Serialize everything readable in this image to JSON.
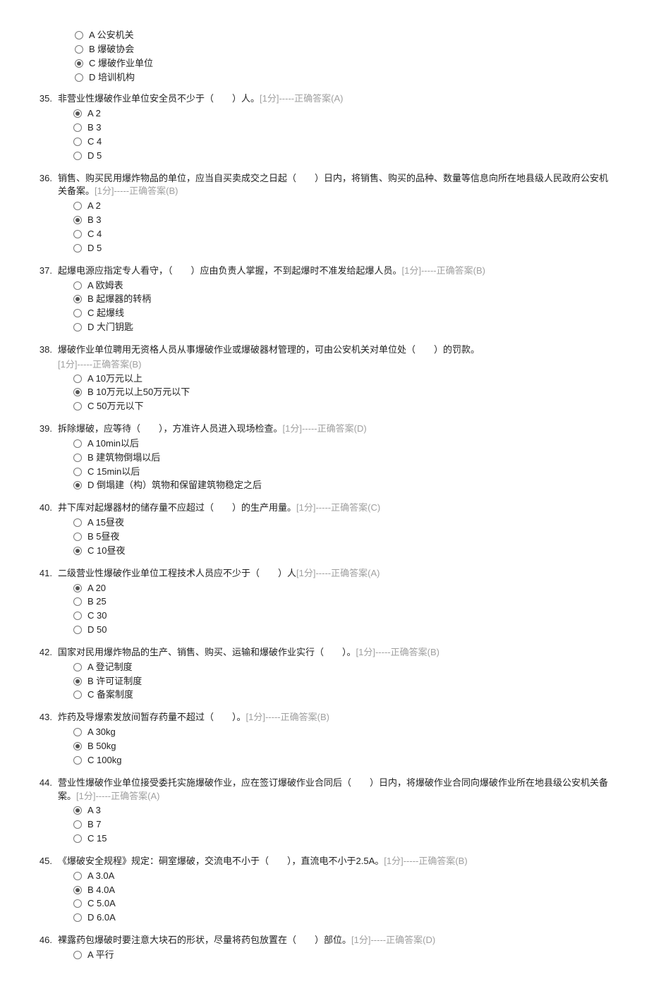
{
  "head_options": [
    {
      "letter": "A",
      "text": "公安机关",
      "selected": false
    },
    {
      "letter": "B",
      "text": "爆破协会",
      "selected": false
    },
    {
      "letter": "C",
      "text": "爆破作业单位",
      "selected": true
    },
    {
      "letter": "D",
      "text": "培训机构",
      "selected": false
    }
  ],
  "questions": [
    {
      "num": "35.",
      "stem": "非营业性爆破作业单位安全员不少于（　　）人。",
      "score": "[1分]-----正确答案(A)",
      "options": [
        {
          "letter": "A",
          "text": "2",
          "selected": true
        },
        {
          "letter": "B",
          "text": "3",
          "selected": false
        },
        {
          "letter": "C",
          "text": "4",
          "selected": false
        },
        {
          "letter": "D",
          "text": "5",
          "selected": false
        }
      ]
    },
    {
      "num": "36.",
      "stem": "销售、购买民用爆炸物品的单位，应当自买卖成交之日起（　　）日内，将销售、购买的品种、数量等信息向所在地县级人民政府公安机关备案。",
      "score": "[1分]-----正确答案(B)",
      "options": [
        {
          "letter": "A",
          "text": "2",
          "selected": false
        },
        {
          "letter": "B",
          "text": "3",
          "selected": true
        },
        {
          "letter": "C",
          "text": "4",
          "selected": false
        },
        {
          "letter": "D",
          "text": "5",
          "selected": false
        }
      ]
    },
    {
      "num": "37.",
      "stem": "起爆电源应指定专人看守，（　　）应由负责人掌握，不到起爆时不准发给起爆人员。",
      "score": "[1分]-----正确答案(B)",
      "options": [
        {
          "letter": "A",
          "text": "欧姆表",
          "selected": false
        },
        {
          "letter": "B",
          "text": "起爆器的转柄",
          "selected": true
        },
        {
          "letter": "C",
          "text": "起爆线",
          "selected": false
        },
        {
          "letter": "D",
          "text": "大门钥匙",
          "selected": false
        }
      ]
    },
    {
      "num": "38.",
      "stem": "爆破作业单位聘用无资格人员从事爆破作业或爆破器材管理的，可由公安机关对单位处（　　）的罚款。",
      "score": "[1分]-----正确答案(B)",
      "scoreOnNewLine": true,
      "options": [
        {
          "letter": "A",
          "text": "10万元以上",
          "selected": false
        },
        {
          "letter": "B",
          "text": "10万元以上50万元以下",
          "selected": true
        },
        {
          "letter": "C",
          "text": "50万元以下",
          "selected": false
        }
      ]
    },
    {
      "num": "39.",
      "stem": "拆除爆破，应等待（　　），方准许人员进入现场检查。",
      "score": "[1分]-----正确答案(D)",
      "options": [
        {
          "letter": "A",
          "text": "10min以后",
          "selected": false
        },
        {
          "letter": "B",
          "text": "建筑物倒塌以后",
          "selected": false
        },
        {
          "letter": "C",
          "text": "15min以后",
          "selected": false
        },
        {
          "letter": "D",
          "text": "倒塌建（构）筑物和保留建筑物稳定之后",
          "selected": true
        }
      ]
    },
    {
      "num": "40.",
      "stem": "井下库对起爆器材的储存量不应超过（　　）的生产用量。",
      "score": "[1分]-----正确答案(C)",
      "options": [
        {
          "letter": "A",
          "text": "15昼夜",
          "selected": false
        },
        {
          "letter": "B",
          "text": "5昼夜",
          "selected": false
        },
        {
          "letter": "C",
          "text": "10昼夜",
          "selected": true
        }
      ]
    },
    {
      "num": "41.",
      "stem": "二级营业性爆破作业单位工程技术人员应不少于（　　）人",
      "score": "[1分]-----正确答案(A)",
      "options": [
        {
          "letter": "A",
          "text": "20",
          "selected": true
        },
        {
          "letter": "B",
          "text": "25",
          "selected": false
        },
        {
          "letter": "C",
          "text": "30",
          "selected": false
        },
        {
          "letter": "D",
          "text": "50",
          "selected": false
        }
      ]
    },
    {
      "num": "42.",
      "stem": "国家对民用爆炸物品的生产、销售、购买、运输和爆破作业实行（　　）。",
      "score": "[1分]-----正确答案(B)",
      "options": [
        {
          "letter": "A",
          "text": "登记制度",
          "selected": false
        },
        {
          "letter": "B",
          "text": "许可证制度",
          "selected": true
        },
        {
          "letter": "C",
          "text": "备案制度",
          "selected": false
        }
      ]
    },
    {
      "num": "43.",
      "stem": "炸药及导爆索发放间暂存药量不超过（　　）。",
      "score": "[1分]-----正确答案(B)",
      "options": [
        {
          "letter": "A",
          "text": "30kg",
          "selected": false
        },
        {
          "letter": "B",
          "text": "50kg",
          "selected": true
        },
        {
          "letter": "C",
          "text": "100kg",
          "selected": false
        }
      ]
    },
    {
      "num": "44.",
      "stem": "营业性爆破作业单位接受委托实施爆破作业，应在签订爆破作业合同后（　　）日内，将爆破作业合同向爆破作业所在地县级公安机关备案。",
      "score": "[1分]-----正确答案(A)",
      "options": [
        {
          "letter": "A",
          "text": "3",
          "selected": true
        },
        {
          "letter": "B",
          "text": "7",
          "selected": false
        },
        {
          "letter": "C",
          "text": "15",
          "selected": false
        }
      ]
    },
    {
      "num": "45.",
      "stem": "《爆破安全规程》规定：硐室爆破，交流电不小于（　　），直流电不小于2.5A。",
      "score": "[1分]-----正确答案(B)",
      "options": [
        {
          "letter": "A",
          "text": "3.0A",
          "selected": false
        },
        {
          "letter": "B",
          "text": "4.0A",
          "selected": true
        },
        {
          "letter": "C",
          "text": "5.0A",
          "selected": false
        },
        {
          "letter": "D",
          "text": "6.0A",
          "selected": false
        }
      ]
    },
    {
      "num": "46.",
      "stem": "裸露药包爆破时要注意大块石的形状，尽量将药包放置在（　　）部位。",
      "score": "[1分]-----正确答案(D)",
      "options": [
        {
          "letter": "A",
          "text": "平行",
          "selected": false
        }
      ]
    }
  ]
}
